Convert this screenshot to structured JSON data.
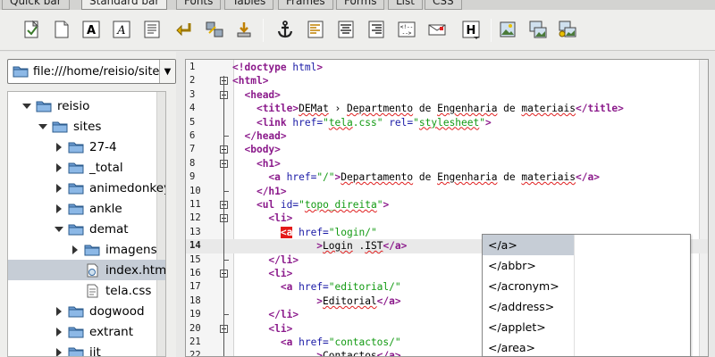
{
  "tabs": [
    "Quick bar",
    "Standard bar",
    "Fonts",
    "Tables",
    "Frames",
    "Forms",
    "List",
    "CSS"
  ],
  "active_tab": "Standard bar",
  "toolbar_icons": [
    "quickstart-icon",
    "new-document-icon",
    "bold-icon",
    "italic-icon",
    "paragraph-icon",
    "break-icon",
    "nbsp-icon",
    "insert-icon",
    "anchor-icon",
    "align-left-icon",
    "align-center-icon",
    "align-right-icon",
    "comment-icon",
    "email-icon",
    "heading-icon",
    "image-icon",
    "thumbnail-icon",
    "image-gallery-icon"
  ],
  "file_browser": {
    "path": "file:///home/reisio/sites",
    "tree": [
      {
        "label": "reisio",
        "kind": "folder",
        "expanded": true
      },
      {
        "label": "sites",
        "kind": "folder",
        "expanded": true
      },
      {
        "label": "27-4",
        "kind": "folder",
        "expanded": false
      },
      {
        "label": "_total",
        "kind": "folder",
        "expanded": false
      },
      {
        "label": "animedonkey",
        "kind": "folder",
        "expanded": false
      },
      {
        "label": "ankle",
        "kind": "folder",
        "expanded": false
      },
      {
        "label": "demat",
        "kind": "folder",
        "expanded": true
      },
      {
        "label": "imagens",
        "kind": "folder",
        "expanded": false
      },
      {
        "label": "index.html",
        "kind": "html",
        "selected": true
      },
      {
        "label": "tela.css",
        "kind": "css"
      },
      {
        "label": "dogwood",
        "kind": "folder",
        "expanded": false
      },
      {
        "label": "extrant",
        "kind": "folder",
        "expanded": false
      },
      {
        "label": "ijt",
        "kind": "folder",
        "expanded": false
      }
    ]
  },
  "editor": {
    "current_line": 14,
    "lines": [
      "<!doctype html>",
      "<html>",
      "  <head>",
      "    <title>DEMat › Departmento de Engenharia de materiais</title>",
      "    <link href=\"tela.css\" rel=\"stylesheet\">",
      "  </head>",
      "  <body>",
      "    <h1>",
      "      <a href=\"/\">Departamento de Engenharia de materiais</a>",
      "    </h1>",
      "    <ul id=\"topo_direita\">",
      "      <li>",
      "        <a href=\"login/\"",
      "              >Login .IST</a>",
      "      </li>",
      "      <li>",
      "        <a href=\"editorial/\"",
      "              >Editorial</a>",
      "      </li>",
      "      <li>",
      "        <a href=\"contactos/\"",
      "              >Contactos</a>"
    ]
  },
  "autocomplete": {
    "options": [
      "</a>",
      "</abbr>",
      "</acronym>",
      "</address>",
      "</applet>",
      "</area>"
    ],
    "selected": "</a>"
  },
  "colors": {
    "tag": "#8b1a8b",
    "attribute": "#1a1aa6",
    "string": "#129a12",
    "selection": "#c6cdd6",
    "match_highlight": "#e41a1a"
  }
}
